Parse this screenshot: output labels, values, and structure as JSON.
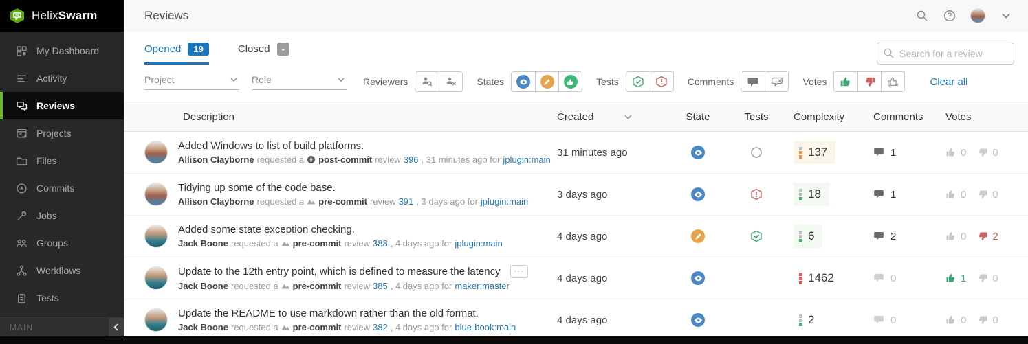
{
  "brand": {
    "helix": "Helix",
    "swarm": "Swarm"
  },
  "sidebar": {
    "items": [
      {
        "label": "My Dashboard",
        "icon": "dashboard-icon",
        "active": false
      },
      {
        "label": "Activity",
        "icon": "activity-icon",
        "active": false
      },
      {
        "label": "Reviews",
        "icon": "reviews-icon",
        "active": true
      },
      {
        "label": "Projects",
        "icon": "projects-icon",
        "active": false
      },
      {
        "label": "Files",
        "icon": "files-icon",
        "active": false
      },
      {
        "label": "Commits",
        "icon": "commits-icon",
        "active": false
      },
      {
        "label": "Jobs",
        "icon": "jobs-icon",
        "active": false
      },
      {
        "label": "Groups",
        "icon": "groups-icon",
        "active": false
      },
      {
        "label": "Workflows",
        "icon": "workflows-icon",
        "active": false
      },
      {
        "label": "Tests",
        "icon": "tests-icon",
        "active": false
      }
    ],
    "section_label": "MAIN"
  },
  "header": {
    "title": "Reviews",
    "icons": [
      "search-icon",
      "help-icon",
      "user-avatar",
      "chevron-down-icon"
    ]
  },
  "tabs": [
    {
      "label": "Opened",
      "count": "19",
      "active": true
    },
    {
      "label": "Closed",
      "count": "-",
      "active": false
    }
  ],
  "search": {
    "placeholder": "Search for a review"
  },
  "filters": {
    "project_label": "Project",
    "role_label": "Role",
    "reviewers_label": "Reviewers",
    "reviewers_icons": [
      "user-search-icon",
      "user-x-icon"
    ],
    "states_label": "States",
    "states_icons": [
      "needs-review-icon",
      "needs-revision-icon",
      "approved-icon"
    ],
    "tests_label": "Tests",
    "tests_icons": [
      "tests-passed-icon",
      "tests-failed-icon"
    ],
    "comments_label": "Comments",
    "comments_icons": [
      "has-comments-icon",
      "no-comments-icon"
    ],
    "votes_label": "Votes",
    "votes_icons": [
      "voted-up-icon",
      "voted-down-icon",
      "no-votes-icon"
    ],
    "clear_all": "Clear all"
  },
  "table": {
    "columns": [
      "Description",
      "Created",
      "State",
      "Tests",
      "Complexity",
      "Comments",
      "Votes"
    ],
    "meta_words": {
      "requested": "requested a",
      "review": "review",
      "for": "for"
    },
    "ellipsis_label": "···",
    "rows": [
      {
        "title": "Added Windows to list of build platforms.",
        "author": "Allison Clayborne",
        "avatar": "allison",
        "commit_type": "post-commit",
        "review_id": "396",
        "meta_tail": ", 31 minutes ago for",
        "branch": "jplugin:main",
        "created": "31 minutes ago",
        "state": "needs-review",
        "tests": "running",
        "complexity": "137",
        "complexity_colors": [
          "#b9bfc2",
          "#e79a4d",
          "#e79a4d"
        ],
        "complexity_bg": "#fcf6ea",
        "comments": "1",
        "comments_active": true,
        "votes_up": "0",
        "votes_down": "0",
        "up_active": false,
        "down_active": false,
        "has_ellipsis": false
      },
      {
        "title": "Tidying up some of the code base.",
        "author": "Allison Clayborne",
        "avatar": "allison",
        "commit_type": "pre-commit",
        "review_id": "391",
        "meta_tail": ", 3 days ago for",
        "branch": "jplugin:main",
        "created": "3 days ago",
        "state": "needs-review",
        "tests": "failed",
        "complexity": "18",
        "complexity_colors": [
          "#b9bfc2",
          "#b9bfc2",
          "#4cae74"
        ],
        "complexity_bg": "#f1f9f1",
        "comments": "1",
        "comments_active": true,
        "votes_up": "0",
        "votes_down": "0",
        "up_active": false,
        "down_active": false,
        "has_ellipsis": false
      },
      {
        "title": "Added some state exception checking.",
        "author": "Jack Boone",
        "avatar": "jack",
        "commit_type": "pre-commit",
        "review_id": "388",
        "meta_tail": ", 4 days ago for",
        "branch": "jplugin:main",
        "created": "4 days ago",
        "state": "needs-revision",
        "tests": "passed",
        "complexity": "6",
        "complexity_colors": [
          "#b9bfc2",
          "#b9bfc2",
          "#4cae74"
        ],
        "complexity_bg": "#f1f9f1",
        "comments": "2",
        "comments_active": true,
        "votes_up": "0",
        "votes_down": "2",
        "up_active": false,
        "down_active": true,
        "has_ellipsis": false
      },
      {
        "title": "Update to the 12th entry point, which is defined to measure the latency",
        "author": "Jack Boone",
        "avatar": "jack",
        "commit_type": "pre-commit",
        "review_id": "385",
        "meta_tail": ", 4 days ago for",
        "branch": "maker:master",
        "created": "4 days ago",
        "state": "needs-review",
        "tests": "none",
        "complexity": "1462",
        "complexity_colors": [
          "#d4605c",
          "#d4605c",
          "#d4605c"
        ],
        "complexity_bg": "#ffffff",
        "comments": "0",
        "comments_active": false,
        "votes_up": "1",
        "votes_down": "0",
        "up_active": true,
        "down_active": false,
        "has_ellipsis": true
      },
      {
        "title": "Update the README to use markdown rather than the old format.",
        "author": "Jack Boone",
        "avatar": "jack",
        "commit_type": "pre-commit",
        "review_id": "382",
        "meta_tail": ", 4 days ago for",
        "branch": "blue-book:main",
        "created": "4 days ago",
        "state": "needs-review",
        "tests": "none",
        "complexity": "2",
        "complexity_colors": [
          "#b9bfc2",
          "#b9bfc2",
          "#4cae74"
        ],
        "complexity_bg": "#ffffff",
        "comments": "0",
        "comments_active": false,
        "votes_up": "0",
        "votes_down": "0",
        "up_active": false,
        "down_active": false,
        "has_ellipsis": false
      }
    ]
  },
  "colors": {
    "accent_blue": "#1b76bc",
    "brand_green": "#6ab82d",
    "state_review_blue": "#4a88c7",
    "state_revision_orange": "#e8a44a",
    "state_approved_green": "#3db874",
    "tests_passed_green": "#3aa86f",
    "tests_failed_red": "#c9605c",
    "vote_up_green": "#3ea573",
    "vote_down_red": "#cd5f5c",
    "link_blue": "#2279bd"
  }
}
